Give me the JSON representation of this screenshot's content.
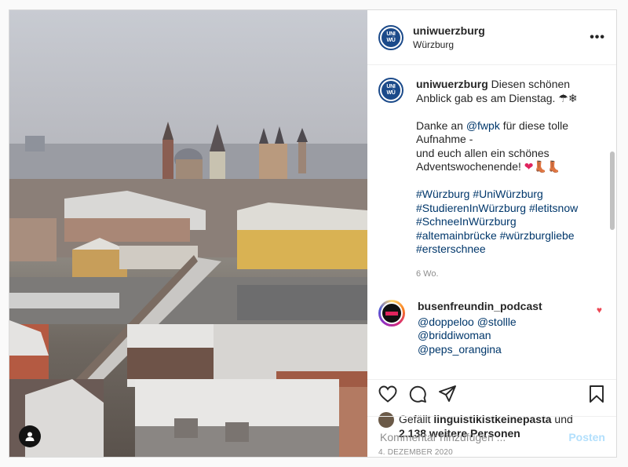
{
  "post": {
    "username": "uniwuerzburg",
    "location": "Würzburg",
    "logo_text_top": "UNI",
    "logo_text_bottom": "WÜ",
    "more_label": "•••"
  },
  "caption": {
    "username": "uniwuerzburg",
    "line1": "Diesen schönen Anblick gab es am Dienstag. ☂❄",
    "line2": "Danke an ",
    "mention": "@fwpk",
    "line2b": " für diese tolle Aufnahme -",
    "line3": "und euch allen ein schönes Adventswochenende! ",
    "line3_emoji": "❤",
    "line3_tail": "👢👢",
    "hashtags": "#Würzburg #UniWürzburg #StudierenInWürzburg #letitsnow #SchneeInWürzburg #altemainbrücke #würzburgliebe #ersterschnee",
    "time": "6 Wo."
  },
  "comment": {
    "username": "busenfreundin_podcast",
    "text": "@doppeloo @stollle @briddiwoman @peps_orangina",
    "like_icon": "♥"
  },
  "likes": {
    "prefix": "Gefällt ",
    "user": "linguistikistkeinepasta",
    "mid": " und",
    "count": "2.138 weitere Personen"
  },
  "date": "4. DEZEMBER 2020",
  "add_comment": {
    "placeholder": "Kommentar hinzufügen ...",
    "post_label": "Posten"
  },
  "icons": [
    "heart-icon",
    "comment-icon",
    "share-icon",
    "bookmark-icon",
    "user-tag-icon",
    "more-icon"
  ]
}
